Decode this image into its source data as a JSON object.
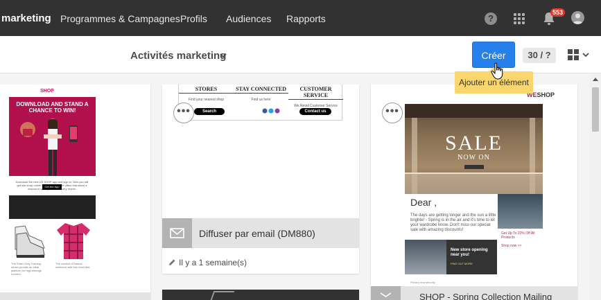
{
  "nav": {
    "brand": "marketing",
    "items": [
      "Programmes & Campagnes",
      "Profils",
      "Audiences",
      "Rapports"
    ],
    "help_label": "?",
    "notifications_badge": "553"
  },
  "subbar": {
    "title": "Activités marketing",
    "create_label": "Créer",
    "counter": "30 / ?",
    "tooltip": "Ajouter un élément"
  },
  "cards": {
    "left": {
      "logo": "SHOP",
      "headline": "DOWNLOAD AND STAND A CHANCE TO WIN!",
      "button": "Get the App"
    },
    "middle": {
      "preview_cols": [
        {
          "head": "STORES",
          "sub": "Find your nearest shop",
          "pill": "Search"
        },
        {
          "head": "STAY CONNECTED",
          "sub": "Find us here",
          "pill": ""
        },
        {
          "head": "CUSTOMER SERVICE",
          "sub": "We.Retail Customer Service",
          "pill": "Contact us"
        }
      ],
      "more_label": "•••",
      "title": "Diffuser par email (DM880)",
      "meta": "Il y a 1 semaine(s)"
    },
    "right": {
      "more_label": "•••",
      "logo_prefix": "WE",
      "logo": "SHOP",
      "sale": "SALE",
      "now_on": "NOW ON",
      "dear": "Dear ,",
      "body": "The days are getting longer and the sun a little brighter - Spring is in the air and it's time to let your wardrobe know. Don't miss our special sale with amazing discounts!",
      "side_offer": "Get Up To 20% Off All Products",
      "side_link": "Shop now >>",
      "store_title": "New store opening near you!",
      "store_link": "FIND OUT MORE",
      "privacy": "Privacy and security",
      "footer_title": "SHOP - Spring Collection Mailing"
    }
  },
  "colors": {
    "topnav": "#323232",
    "accent": "#2680eb",
    "tooltip": "#fbd66c",
    "badge": "#e0362c"
  }
}
